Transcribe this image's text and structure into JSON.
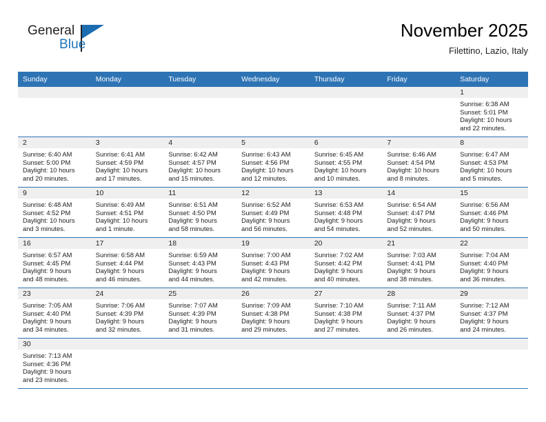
{
  "brand": {
    "name_part1": "General",
    "name_part2": "Blue",
    "logo_icon": "triangle-flag-icon"
  },
  "header": {
    "title": "November 2025",
    "subtitle": "Filettino, Lazio, Italy"
  },
  "colors": {
    "header_blue": "#2e74b5",
    "brand_blue": "#1b75bb",
    "daynum_band": "#efefef",
    "text": "#222222"
  },
  "weekday_headers": [
    "Sunday",
    "Monday",
    "Tuesday",
    "Wednesday",
    "Thursday",
    "Friday",
    "Saturday"
  ],
  "weeks": [
    [
      {
        "day": "",
        "sunrise": "",
        "sunset": "",
        "daylight1": "",
        "daylight2": ""
      },
      {
        "day": "",
        "sunrise": "",
        "sunset": "",
        "daylight1": "",
        "daylight2": ""
      },
      {
        "day": "",
        "sunrise": "",
        "sunset": "",
        "daylight1": "",
        "daylight2": ""
      },
      {
        "day": "",
        "sunrise": "",
        "sunset": "",
        "daylight1": "",
        "daylight2": ""
      },
      {
        "day": "",
        "sunrise": "",
        "sunset": "",
        "daylight1": "",
        "daylight2": ""
      },
      {
        "day": "",
        "sunrise": "",
        "sunset": "",
        "daylight1": "",
        "daylight2": ""
      },
      {
        "day": "1",
        "sunrise": "Sunrise: 6:38 AM",
        "sunset": "Sunset: 5:01 PM",
        "daylight1": "Daylight: 10 hours",
        "daylight2": "and 22 minutes."
      }
    ],
    [
      {
        "day": "2",
        "sunrise": "Sunrise: 6:40 AM",
        "sunset": "Sunset: 5:00 PM",
        "daylight1": "Daylight: 10 hours",
        "daylight2": "and 20 minutes."
      },
      {
        "day": "3",
        "sunrise": "Sunrise: 6:41 AM",
        "sunset": "Sunset: 4:59 PM",
        "daylight1": "Daylight: 10 hours",
        "daylight2": "and 17 minutes."
      },
      {
        "day": "4",
        "sunrise": "Sunrise: 6:42 AM",
        "sunset": "Sunset: 4:57 PM",
        "daylight1": "Daylight: 10 hours",
        "daylight2": "and 15 minutes."
      },
      {
        "day": "5",
        "sunrise": "Sunrise: 6:43 AM",
        "sunset": "Sunset: 4:56 PM",
        "daylight1": "Daylight: 10 hours",
        "daylight2": "and 12 minutes."
      },
      {
        "day": "6",
        "sunrise": "Sunrise: 6:45 AM",
        "sunset": "Sunset: 4:55 PM",
        "daylight1": "Daylight: 10 hours",
        "daylight2": "and 10 minutes."
      },
      {
        "day": "7",
        "sunrise": "Sunrise: 6:46 AM",
        "sunset": "Sunset: 4:54 PM",
        "daylight1": "Daylight: 10 hours",
        "daylight2": "and 8 minutes."
      },
      {
        "day": "8",
        "sunrise": "Sunrise: 6:47 AM",
        "sunset": "Sunset: 4:53 PM",
        "daylight1": "Daylight: 10 hours",
        "daylight2": "and 5 minutes."
      }
    ],
    [
      {
        "day": "9",
        "sunrise": "Sunrise: 6:48 AM",
        "sunset": "Sunset: 4:52 PM",
        "daylight1": "Daylight: 10 hours",
        "daylight2": "and 3 minutes."
      },
      {
        "day": "10",
        "sunrise": "Sunrise: 6:49 AM",
        "sunset": "Sunset: 4:51 PM",
        "daylight1": "Daylight: 10 hours",
        "daylight2": "and 1 minute."
      },
      {
        "day": "11",
        "sunrise": "Sunrise: 6:51 AM",
        "sunset": "Sunset: 4:50 PM",
        "daylight1": "Daylight: 9 hours",
        "daylight2": "and 58 minutes."
      },
      {
        "day": "12",
        "sunrise": "Sunrise: 6:52 AM",
        "sunset": "Sunset: 4:49 PM",
        "daylight1": "Daylight: 9 hours",
        "daylight2": "and 56 minutes."
      },
      {
        "day": "13",
        "sunrise": "Sunrise: 6:53 AM",
        "sunset": "Sunset: 4:48 PM",
        "daylight1": "Daylight: 9 hours",
        "daylight2": "and 54 minutes."
      },
      {
        "day": "14",
        "sunrise": "Sunrise: 6:54 AM",
        "sunset": "Sunset: 4:47 PM",
        "daylight1": "Daylight: 9 hours",
        "daylight2": "and 52 minutes."
      },
      {
        "day": "15",
        "sunrise": "Sunrise: 6:56 AM",
        "sunset": "Sunset: 4:46 PM",
        "daylight1": "Daylight: 9 hours",
        "daylight2": "and 50 minutes."
      }
    ],
    [
      {
        "day": "16",
        "sunrise": "Sunrise: 6:57 AM",
        "sunset": "Sunset: 4:45 PM",
        "daylight1": "Daylight: 9 hours",
        "daylight2": "and 48 minutes."
      },
      {
        "day": "17",
        "sunrise": "Sunrise: 6:58 AM",
        "sunset": "Sunset: 4:44 PM",
        "daylight1": "Daylight: 9 hours",
        "daylight2": "and 46 minutes."
      },
      {
        "day": "18",
        "sunrise": "Sunrise: 6:59 AM",
        "sunset": "Sunset: 4:43 PM",
        "daylight1": "Daylight: 9 hours",
        "daylight2": "and 44 minutes."
      },
      {
        "day": "19",
        "sunrise": "Sunrise: 7:00 AM",
        "sunset": "Sunset: 4:43 PM",
        "daylight1": "Daylight: 9 hours",
        "daylight2": "and 42 minutes."
      },
      {
        "day": "20",
        "sunrise": "Sunrise: 7:02 AM",
        "sunset": "Sunset: 4:42 PM",
        "daylight1": "Daylight: 9 hours",
        "daylight2": "and 40 minutes."
      },
      {
        "day": "21",
        "sunrise": "Sunrise: 7:03 AM",
        "sunset": "Sunset: 4:41 PM",
        "daylight1": "Daylight: 9 hours",
        "daylight2": "and 38 minutes."
      },
      {
        "day": "22",
        "sunrise": "Sunrise: 7:04 AM",
        "sunset": "Sunset: 4:40 PM",
        "daylight1": "Daylight: 9 hours",
        "daylight2": "and 36 minutes."
      }
    ],
    [
      {
        "day": "23",
        "sunrise": "Sunrise: 7:05 AM",
        "sunset": "Sunset: 4:40 PM",
        "daylight1": "Daylight: 9 hours",
        "daylight2": "and 34 minutes."
      },
      {
        "day": "24",
        "sunrise": "Sunrise: 7:06 AM",
        "sunset": "Sunset: 4:39 PM",
        "daylight1": "Daylight: 9 hours",
        "daylight2": "and 32 minutes."
      },
      {
        "day": "25",
        "sunrise": "Sunrise: 7:07 AM",
        "sunset": "Sunset: 4:39 PM",
        "daylight1": "Daylight: 9 hours",
        "daylight2": "and 31 minutes."
      },
      {
        "day": "26",
        "sunrise": "Sunrise: 7:09 AM",
        "sunset": "Sunset: 4:38 PM",
        "daylight1": "Daylight: 9 hours",
        "daylight2": "and 29 minutes."
      },
      {
        "day": "27",
        "sunrise": "Sunrise: 7:10 AM",
        "sunset": "Sunset: 4:38 PM",
        "daylight1": "Daylight: 9 hours",
        "daylight2": "and 27 minutes."
      },
      {
        "day": "28",
        "sunrise": "Sunrise: 7:11 AM",
        "sunset": "Sunset: 4:37 PM",
        "daylight1": "Daylight: 9 hours",
        "daylight2": "and 26 minutes."
      },
      {
        "day": "29",
        "sunrise": "Sunrise: 7:12 AM",
        "sunset": "Sunset: 4:37 PM",
        "daylight1": "Daylight: 9 hours",
        "daylight2": "and 24 minutes."
      }
    ],
    [
      {
        "day": "30",
        "sunrise": "Sunrise: 7:13 AM",
        "sunset": "Sunset: 4:36 PM",
        "daylight1": "Daylight: 9 hours",
        "daylight2": "and 23 minutes."
      },
      {
        "day": "",
        "sunrise": "",
        "sunset": "",
        "daylight1": "",
        "daylight2": ""
      },
      {
        "day": "",
        "sunrise": "",
        "sunset": "",
        "daylight1": "",
        "daylight2": ""
      },
      {
        "day": "",
        "sunrise": "",
        "sunset": "",
        "daylight1": "",
        "daylight2": ""
      },
      {
        "day": "",
        "sunrise": "",
        "sunset": "",
        "daylight1": "",
        "daylight2": ""
      },
      {
        "day": "",
        "sunrise": "",
        "sunset": "",
        "daylight1": "",
        "daylight2": ""
      },
      {
        "day": "",
        "sunrise": "",
        "sunset": "",
        "daylight1": "",
        "daylight2": ""
      }
    ]
  ]
}
